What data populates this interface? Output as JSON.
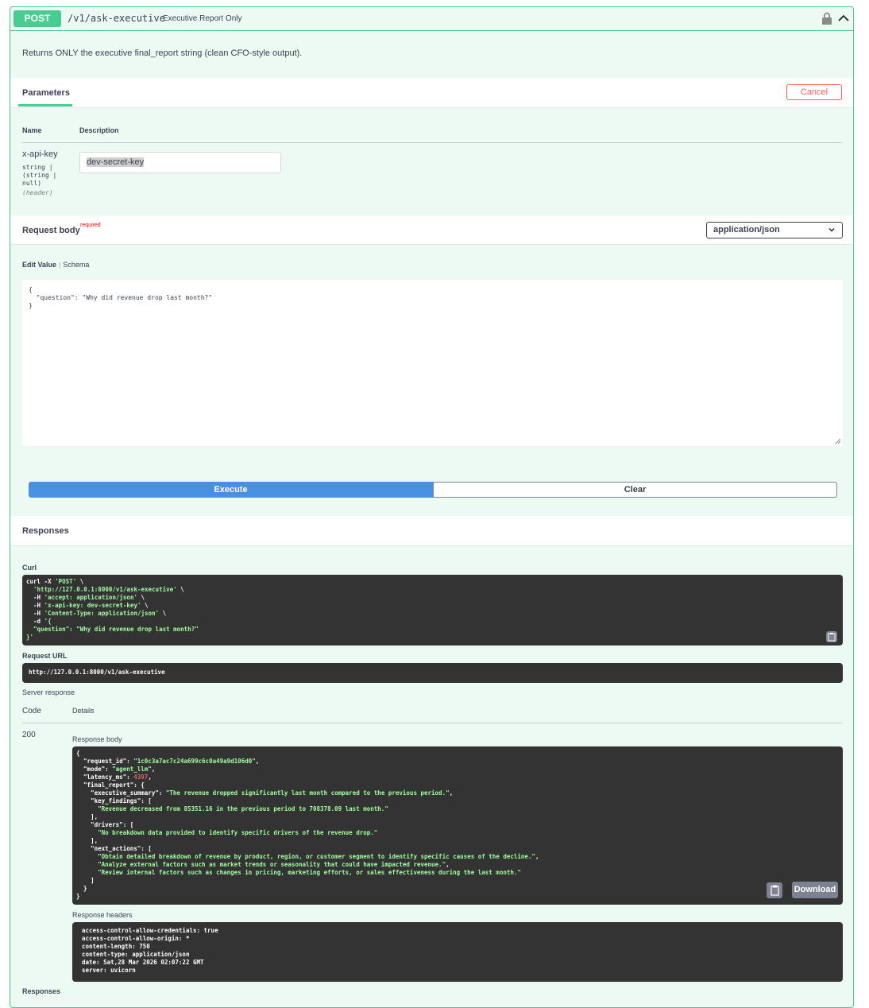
{
  "op": {
    "method": "POST",
    "path": "/v1/ask-executive",
    "summary": "Executive Report Only",
    "description": "Returns ONLY the executive final_report string (clean CFO-style output)."
  },
  "params": {
    "tab": "Parameters",
    "cancel": "Cancel",
    "col_name": "Name",
    "col_desc": "Description",
    "items": [
      {
        "name": "x-api-key",
        "type": "string |\n(string |\nnull)",
        "in": "(header)",
        "value": "dev-secret-key"
      }
    ]
  },
  "request_body": {
    "title": "Request body",
    "required": "required",
    "content_type": "application/json",
    "tab_edit": "Edit Value",
    "tab_schema": "Schema",
    "value": "{\n  \"question\": \"Why did revenue drop last month?\"\n}"
  },
  "actions": {
    "execute": "Execute",
    "clear": "Clear"
  },
  "responses": {
    "title": "Responses",
    "curl_label": "Curl",
    "request_url_label": "Request URL",
    "request_url": "http://127.0.0.1:8000/v1/ask-executive",
    "server_response_label": "Server response",
    "col_code": "Code",
    "col_details": "Details",
    "code": "200",
    "response_body_label": "Response body",
    "response_headers_label": "Response headers",
    "download": "Download",
    "bottom_label": "Responses",
    "curl": {
      "line1": "curl -X ",
      "method": "'POST'",
      "url": "'http://127.0.0.1:8000/v1/ask-executive'",
      "h1": "'accept: application/json'",
      "h2": "'x-api-key: dev-secret-key'",
      "h3": "'Content-Type: application/json'",
      "d": "'{",
      "q": "\"question\": \"Why did revenue drop last month?\"",
      "end": "}'"
    },
    "body": {
      "request_id": "\"1c0c3a7ac7c24a699c6c0a49a9d106d0\"",
      "mode": "\"agent_llm\"",
      "latency_ms": "4397",
      "executive_summary": "\"The revenue dropped significantly last month compared to the previous period.\"",
      "key_finding": "\"Revenue decreased from 85351.16 in the previous period to 708378.09 last month.\"",
      "driver": "\"No breakdown data provided to identify specific drivers of the revenue drop.\"",
      "next_action_1": "\"Obtain detailed breakdown of revenue by product, region, or customer segment to identify specific causes of the decline.\"",
      "next_action_2": "\"Analyze external factors such as market trends or seasonality that could have impacted revenue.\"",
      "next_action_3": "\"Review internal factors such as changes in pricing, marketing efforts, or sales effectiveness during the last month.\""
    },
    "headers": [
      "access-control-allow-credentials: true",
      "access-control-allow-origin: *",
      "content-length: 750",
      "content-type: application/json",
      "date: Sat,28 Mar 2026 02:07:22 GMT",
      "server: uvicorn"
    ]
  },
  "colors": {
    "post": "#49cc90",
    "execute": "#4990e2",
    "cancel": "#ff6060"
  }
}
